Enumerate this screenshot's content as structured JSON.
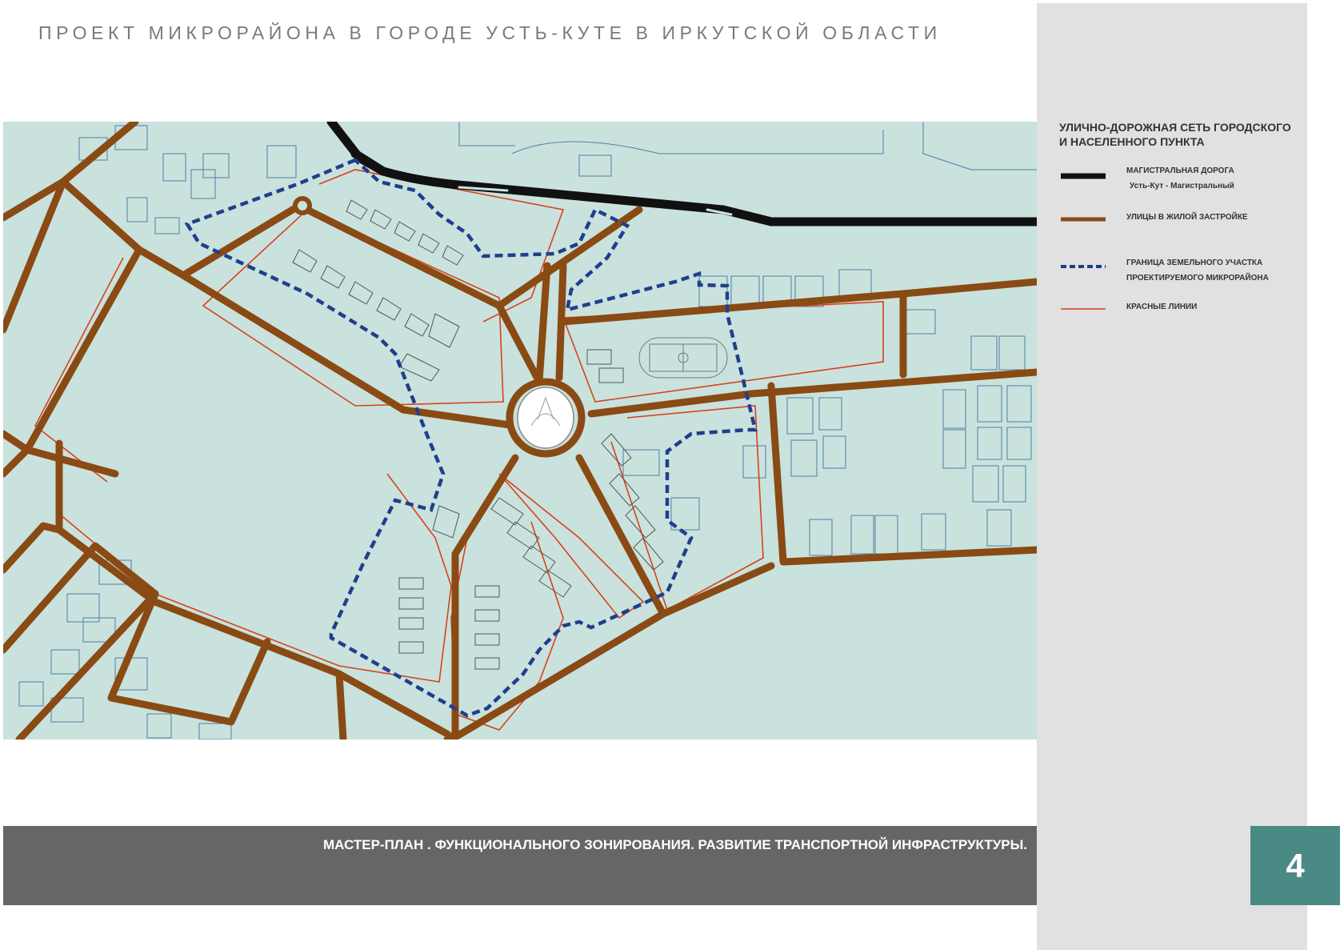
{
  "page": {
    "title": "ПРОЕКТ МИКРОРАЙОНА В ГОРОДЕ УСТЬ-КУТЕ В ИРКУТСКОЙ ОБЛАСТИ",
    "footer_caption": "МАСТЕР-ПЛАН . ФУНКЦИОНАЛЬНОГО ЗОНИРОВАНИЯ. РАЗВИТИЕ ТРАНСПОРТНОЙ ИНФРАСТРУКТУРЫ.",
    "page_number": "4"
  },
  "legend": {
    "title": "УЛИЧНО-ДОРОЖНАЯ СЕТЬ ГОРОДСКОГО И НАСЕЛЕННОГО ПУНКТА",
    "items": [
      {
        "symbol": "black-thick-line",
        "color": "#111111",
        "line1": "МАГИСТРАЛЬНАЯ ДОРОГА",
        "line2": "Усть-Кут  -  Магистральный"
      },
      {
        "symbol": "brown-line",
        "color": "#8a4a14",
        "line1": "УЛИЦЫ В  ЖИЛОЙ ЗАСТРОЙКЕ",
        "line2": ""
      },
      {
        "symbol": "blue-dashed-line",
        "color": "#1f3f8c",
        "line1": "ГРАНИЦА ЗЕМЕЛЬНОГО УЧАСТКА",
        "line2": "ПРОЕКТИРУЕМОГО  МИКРОРАЙОНА"
      },
      {
        "symbol": "red-thin-line",
        "color": "#d8411c",
        "line1": "КРАСНЫЕ ЛИНИИ",
        "line2": ""
      }
    ]
  },
  "colors": {
    "map_background": "#c9e2dd",
    "sidebar": "#e1e1e1",
    "footer": "#666666",
    "badge": "#4a8a84"
  }
}
